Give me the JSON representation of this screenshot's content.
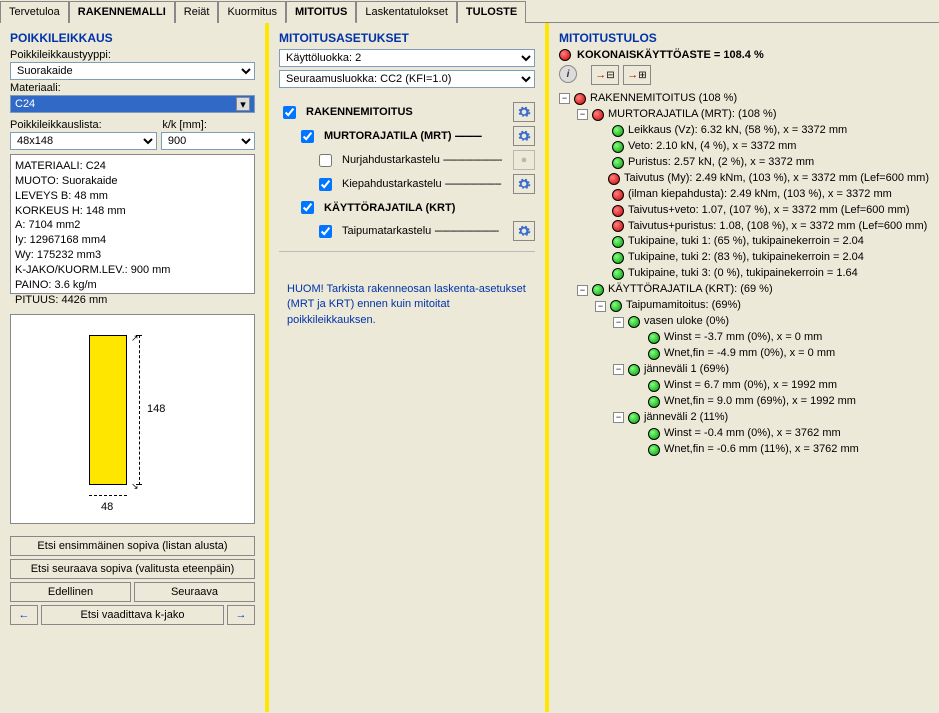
{
  "tabs": [
    "Tervetuloa",
    "RAKENNEMALLI",
    "Reiät",
    "Kuormitus",
    "MITOITUS",
    "Laskentatulokset",
    "TULOSTE"
  ],
  "active_tab": "MITOITUS",
  "col1": {
    "title": "POIKKILEIKKAUS",
    "type_label": "Poikkileikkaustyyppi:",
    "type_value": "Suorakaide",
    "mat_label": "Materiaali:",
    "mat_value": "C24",
    "list_label": "Poikkileikkauslista:",
    "kk_label": "k/k [mm]:",
    "list_value": "48x148",
    "kk_value": "900",
    "info": [
      "MATERIAALI: C24",
      "MUOTO: Suorakaide",
      "LEVEYS B: 48 mm",
      "KORKEUS H: 148 mm",
      "A: 7104 mm2",
      "Iy: 12967168 mm4",
      "Wy: 175232 mm3",
      "K-JAKO/KUORM.LEV.: 900 mm",
      "PAINO: 3.6 kg/m",
      "PITUUS: 4426 mm"
    ],
    "dim_h": "148",
    "dim_w": "48",
    "btn1": "Etsi ensimmäinen sopiva (listan alusta)",
    "btn2": "Etsi seuraava sopiva (valitusta eteenpäin)",
    "btn_prev": "Edellinen",
    "btn_next": "Seuraava",
    "btn_kjako": "Etsi vaadittava k-jako"
  },
  "col2": {
    "title": "MITOITUSASETUKSET",
    "kayttoluokka": "Käyttöluokka: 2",
    "seuraamus": "Seuraamusluokka: CC2 (KFI=1.0)",
    "rakenne": "RAKENNEMITOITUS",
    "mrt": "MURTORAJATILA (MRT)",
    "nurj": "Nurjahdustarkastelu",
    "kiep": "Kiepahdustarkastelu",
    "krt": "KÄYTTÖRAJATILA (KRT)",
    "taip": "Taipumatarkastelu",
    "note": "HUOM! Tarkista rakenneosan laskenta-asetukset (MRT ja KRT) ennen kuin mitoitat poikkileikkauksen."
  },
  "col3": {
    "title": "MITOITUSTULOS",
    "overall": "KOKONAISKÄYTTÖASTE = 108.4 %",
    "tree": [
      {
        "lvl": 0,
        "exp": "-",
        "dot": "red",
        "txt": "RAKENNEMITOITUS (108 %)"
      },
      {
        "lvl": 1,
        "exp": "-",
        "dot": "red",
        "txt": "MURTORAJATILA (MRT): (108 %)"
      },
      {
        "lvl": 2,
        "exp": "",
        "dot": "green",
        "txt": "Leikkaus (Vz): 6.32 kN, (58 %), x = 3372 mm"
      },
      {
        "lvl": 2,
        "exp": "",
        "dot": "green",
        "txt": "Veto: 2.10 kN, (4 %), x = 3372 mm"
      },
      {
        "lvl": 2,
        "exp": "",
        "dot": "green",
        "txt": "Puristus: 2.57 kN, (2 %), x = 3372 mm"
      },
      {
        "lvl": 2,
        "exp": "",
        "dot": "red",
        "txt": "Taivutus (My): 2.49 kNm, (103 %), x = 3372 mm (Lef=600 mm)"
      },
      {
        "lvl": 2,
        "exp": "",
        "dot": "red",
        "txt": "(ilman kiepahdusta): 2.49 kNm, (103 %), x = 3372 mm"
      },
      {
        "lvl": 2,
        "exp": "",
        "dot": "red",
        "txt": "Taivutus+veto: 1.07, (107 %), x = 3372 mm (Lef=600 mm)"
      },
      {
        "lvl": 2,
        "exp": "",
        "dot": "red",
        "txt": "Taivutus+puristus: 1.08, (108 %), x = 3372 mm (Lef=600 mm)"
      },
      {
        "lvl": 2,
        "exp": "",
        "dot": "green",
        "txt": "Tukipaine, tuki 1: (65 %), tukipainekerroin = 2.04"
      },
      {
        "lvl": 2,
        "exp": "",
        "dot": "green",
        "txt": "Tukipaine, tuki 2: (83 %), tukipainekerroin = 2.04"
      },
      {
        "lvl": 2,
        "exp": "",
        "dot": "green",
        "txt": "Tukipaine, tuki 3: (0 %), tukipainekerroin = 1.64"
      },
      {
        "lvl": 1,
        "exp": "-",
        "dot": "green",
        "txt": "KÄYTTÖRAJATILA (KRT): (69 %)"
      },
      {
        "lvl": 2,
        "exp": "-",
        "dot": "green",
        "txt": "Taipumamitoitus: (69%)"
      },
      {
        "lvl": 3,
        "exp": "-",
        "dot": "green",
        "txt": "vasen uloke (0%)"
      },
      {
        "lvl": 4,
        "exp": "",
        "dot": "green",
        "txt": "Winst  = -3.7 mm (0%), x = 0 mm"
      },
      {
        "lvl": 4,
        "exp": "",
        "dot": "green",
        "txt": "Wnet,fin  = -4.9 mm (0%), x = 0 mm"
      },
      {
        "lvl": 3,
        "exp": "-",
        "dot": "green",
        "txt": "jänneväli 1 (69%)"
      },
      {
        "lvl": 4,
        "exp": "",
        "dot": "green",
        "txt": "Winst  = 6.7 mm (0%), x = 1992 mm"
      },
      {
        "lvl": 4,
        "exp": "",
        "dot": "green",
        "txt": "Wnet,fin  = 9.0 mm (69%), x = 1992 mm"
      },
      {
        "lvl": 3,
        "exp": "-",
        "dot": "green",
        "txt": "jänneväli 2 (11%)"
      },
      {
        "lvl": 4,
        "exp": "",
        "dot": "green",
        "txt": "Winst  = -0.4 mm (0%), x = 3762 mm"
      },
      {
        "lvl": 4,
        "exp": "",
        "dot": "green",
        "txt": "Wnet,fin  = -0.6 mm (11%), x = 3762 mm"
      }
    ]
  }
}
